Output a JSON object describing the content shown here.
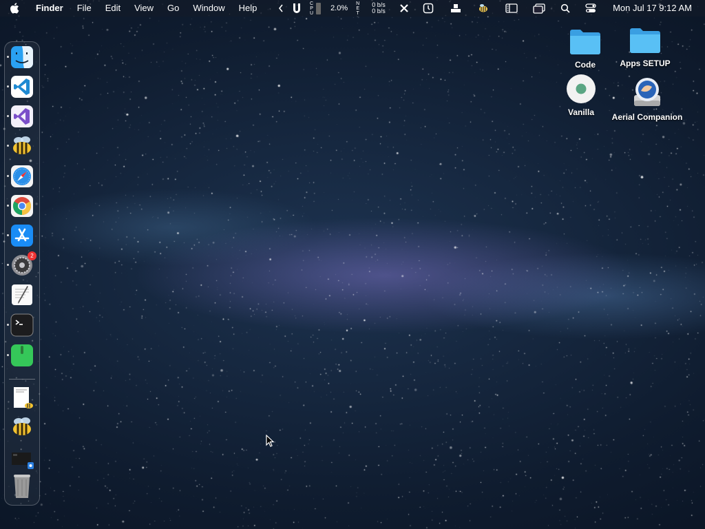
{
  "menubar": {
    "apple_icon": "apple-logo-icon",
    "app_name": "Finder",
    "menus": [
      "File",
      "Edit",
      "View",
      "Go",
      "Window",
      "Help"
    ],
    "status": {
      "cpu_letters": [
        "C",
        "P",
        "U"
      ],
      "cpu_percent": "2.0%",
      "net_letters": [
        "N",
        "E",
        "T"
      ],
      "net_up": "0 b/s",
      "net_down": "0 b/s"
    },
    "clock": "Mon Jul 17  9:12 AM"
  },
  "dock": {
    "items": [
      {
        "name": "finder",
        "icon": "finder-icon",
        "running": true
      },
      {
        "name": "vscode",
        "icon": "vscode-icon",
        "running": true
      },
      {
        "name": "visual-studio",
        "icon": "visual-studio-icon",
        "running": true
      },
      {
        "name": "cyberduck-bee",
        "icon": "bee-icon",
        "running": true
      },
      {
        "name": "safari",
        "icon": "safari-icon",
        "running": true
      },
      {
        "name": "chrome",
        "icon": "chrome-icon",
        "running": true
      },
      {
        "name": "app-store",
        "icon": "app-store-icon",
        "running": true
      },
      {
        "name": "system-settings",
        "icon": "settings-icon",
        "running": true,
        "badge": "2"
      },
      {
        "name": "textedit",
        "icon": "textedit-icon",
        "running": false
      },
      {
        "name": "terminal",
        "icon": "terminal-icon",
        "running": true
      },
      {
        "name": "green-app",
        "icon": "green-app-icon",
        "running": true
      }
    ],
    "recent": [
      {
        "name": "document-preview",
        "icon": "document-icon"
      },
      {
        "name": "bee-recent",
        "icon": "bee-icon"
      },
      {
        "name": "screenshots-folder",
        "icon": "screens-icon"
      },
      {
        "name": "trash",
        "icon": "trash-icon"
      }
    ]
  },
  "desktop": {
    "icons": [
      {
        "label": "Code",
        "icon": "folder-icon"
      },
      {
        "label": "Apps SETUP",
        "icon": "folder-icon"
      },
      {
        "label": "Vanilla",
        "icon": "vanilla-icon"
      },
      {
        "label": "Aerial Companion",
        "icon": "disk-icon"
      }
    ]
  },
  "colors": {
    "folder_blue": "#4fb8f2",
    "badge_red": "#e33333"
  }
}
